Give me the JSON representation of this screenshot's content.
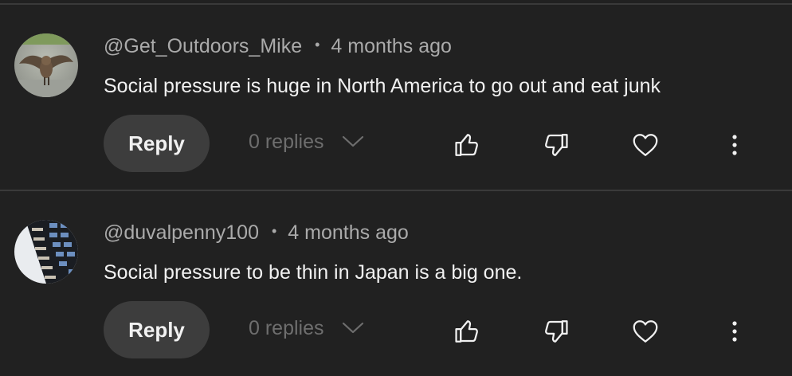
{
  "comments": [
    {
      "author": "@Get_Outdoors_Mike",
      "separator": "•",
      "time": "4 months ago",
      "text": "Social pressure is huge in North America to go out and eat junk",
      "reply_label": "Reply",
      "replies_label": "0 replies",
      "avatar_icon": "owl-photo-avatar"
    },
    {
      "author": "@duvalpenny100",
      "separator": "•",
      "time": "4 months ago",
      "text": "Social pressure to be thin in Japan is a big one.",
      "reply_label": "Reply",
      "replies_label": "0 replies",
      "avatar_icon": "building-photo-avatar"
    }
  ],
  "icons": {
    "like": "thumbs-up-icon",
    "dislike": "thumbs-down-icon",
    "heart": "heart-icon",
    "more": "more-vertical-icon",
    "expand": "chevron-down-icon"
  },
  "colors": {
    "background": "#212121",
    "primary_text": "#f1f1f1",
    "secondary_text": "#aaaaaa",
    "muted_text": "#6e6e6e",
    "button_bg": "#3d3d3d",
    "divider": "#3a3a3a"
  }
}
